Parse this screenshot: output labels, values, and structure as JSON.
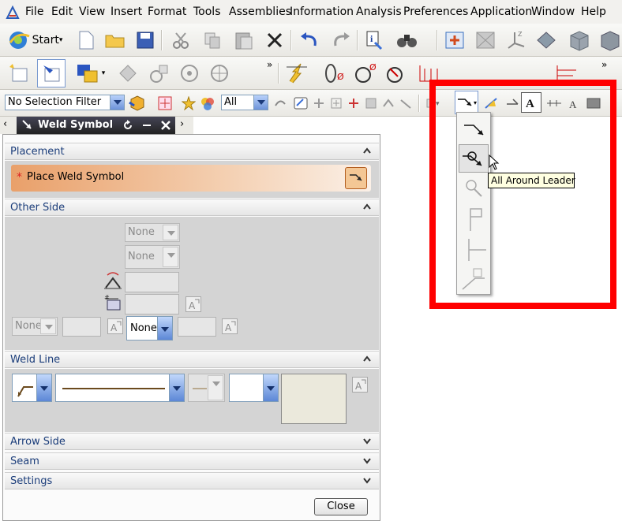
{
  "menu": {
    "items": [
      "File",
      "Edit",
      "View",
      "Insert",
      "Format",
      "Tools",
      "Assemblies",
      "Information",
      "Analysis",
      "Preferences",
      "Application",
      "Window",
      "Help"
    ]
  },
  "toolbar": {
    "start_label": "Start",
    "selection_filter": "No Selection Filter",
    "scope": "All"
  },
  "panel": {
    "title": "Weld Symbol",
    "placement": {
      "header": "Placement",
      "required_marker": "*",
      "place_label": "Place Weld Symbol"
    },
    "other_side": {
      "header": "Other Side",
      "combo1": "None",
      "combo2": "None",
      "combo_left": "None",
      "combo_active": "None"
    },
    "weld_line": {
      "header": "Weld Line"
    },
    "arrow_side": {
      "header": "Arrow Side"
    },
    "seam": {
      "header": "Seam"
    },
    "settings": {
      "header": "Settings"
    },
    "close_label": "Close"
  },
  "dropdown": {
    "items": [
      "leader-icon",
      "all-around-leader-icon",
      "magnifier-leader-icon",
      "flag-leader-icon",
      "tee-leader-icon",
      "staggered-leader-icon"
    ]
  },
  "tooltip": {
    "text": "All Around Leader"
  },
  "colors": {
    "highlight": "#ff0000",
    "accent_orange": "#e9a06a",
    "section_title": "#1b3d7a",
    "weld_line": "#6b4a1e"
  }
}
